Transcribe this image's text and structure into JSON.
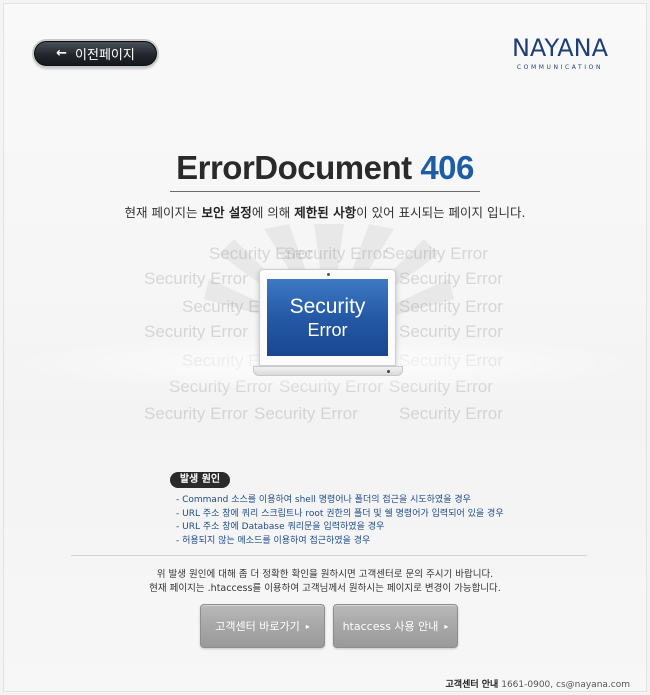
{
  "nav": {
    "back_label": "이전페이지",
    "back_icon": "arrow-left-icon"
  },
  "logo": {
    "brand": "NAYANA",
    "sub": "COMMUNICATION",
    "color": "#1f3f73"
  },
  "header": {
    "title_main": "ErrorDocument",
    "title_code": "406",
    "code_color": "#1e5ca8"
  },
  "description": {
    "part1": "현재 페이지는 ",
    "bold1": "보안 설정",
    "part2": "에 의해 ",
    "bold2": "제한된 사항",
    "part3": "이 있어 표시되는 페이지 입니다."
  },
  "illustration": {
    "screen_line1": "Security",
    "screen_line2": "Error",
    "background_word": "Security Error",
    "screen_color": "#2459a6"
  },
  "causes": {
    "badge": "발생 원인",
    "items": [
      "- Command 소스를 이용하여 shell 명령어나 폴더의 접근을 시도하였을 경우",
      "- URL 주소 창에 쿼리 스크립트나 root 권한의 폴더 및 쉘 명령어가 입력되어 있을 경우",
      "- URL 주소 창에 Database 쿼리문을 입력하였을 경우",
      "- 허용되지 않는 메소드를 이용하여 접근하였을 경우"
    ]
  },
  "notice": {
    "line1": "위 발생 원인에 대해 좀 더 정확한 확인을 원하시면 고객센터로 문의 주시기 바랍니다.",
    "line2": "현재 페이지는 .htaccess를 이용하여 고객님께서 원하시는 페이지로 변경이 가능합니다."
  },
  "buttons": {
    "support": "고객센터 바로가기",
    "htaccess": "htaccess 사용 안내"
  },
  "footer": {
    "label": "고객센터 안내",
    "contact": "1661-0900, cs@nayana.com"
  }
}
